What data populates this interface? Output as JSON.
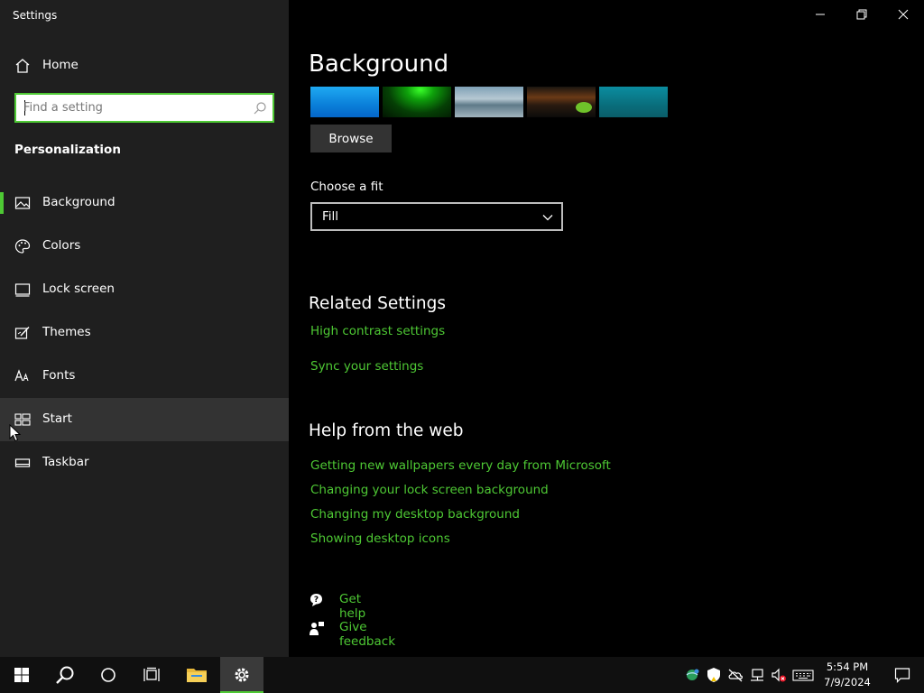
{
  "window": {
    "title": "Settings"
  },
  "sidebar": {
    "home_label": "Home",
    "search": {
      "placeholder": "Find a setting",
      "value": ""
    },
    "section_heading": "Personalization",
    "items": [
      {
        "label": "Background",
        "icon": "picture-icon",
        "selected": true
      },
      {
        "label": "Colors",
        "icon": "palette-icon"
      },
      {
        "label": "Lock screen",
        "icon": "lock-screen-icon"
      },
      {
        "label": "Themes",
        "icon": "themes-icon"
      },
      {
        "label": "Fonts",
        "icon": "fonts-icon"
      },
      {
        "label": "Start",
        "icon": "start-icon",
        "hovered": true
      },
      {
        "label": "Taskbar",
        "icon": "taskbar-icon"
      }
    ]
  },
  "main": {
    "title": "Background",
    "browse_label": "Browse",
    "fit": {
      "label": "Choose a fit",
      "value": "Fill"
    },
    "related": {
      "heading": "Related Settings",
      "links": [
        "High contrast settings",
        "Sync your settings"
      ]
    },
    "help_web": {
      "heading": "Help from the web",
      "links": [
        "Getting new wallpapers every day from Microsoft",
        "Changing your lock screen background",
        "Changing my desktop background",
        "Showing desktop icons"
      ]
    },
    "get_help": "Get help",
    "give_feedback": "Give feedback"
  },
  "taskbar": {
    "time": "5:54 PM",
    "date": "7/9/2024"
  },
  "colors": {
    "accent": "#4ec934",
    "sidebar_bg": "#1f1f1f",
    "content_bg": "#000000",
    "taskbar_bg": "#101010"
  }
}
